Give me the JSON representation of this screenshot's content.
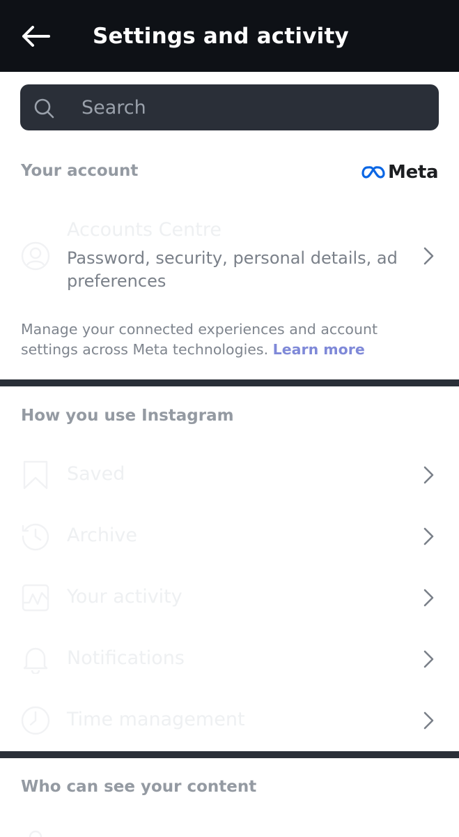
{
  "header": {
    "title": "Settings and activity",
    "back_icon": "arrow-left-icon"
  },
  "search": {
    "placeholder": "Search"
  },
  "your_account": {
    "heading": "Your account",
    "brand": "Meta",
    "accounts_centre": {
      "title": "Accounts Centre",
      "subtitle": "Password, security, personal details, ad preferences"
    },
    "help_text": "Manage your connected experiences and account settings across Meta technologies.",
    "learn_more": "Learn more"
  },
  "how_you_use": {
    "heading": "How you use Instagram",
    "items": [
      {
        "label": "Saved",
        "icon": "bookmark-icon"
      },
      {
        "label": "Archive",
        "icon": "archive-icon"
      },
      {
        "label": "Your activity",
        "icon": "activity-icon"
      },
      {
        "label": "Notifications",
        "icon": "bell-icon"
      },
      {
        "label": "Time management",
        "icon": "clock-icon"
      }
    ]
  },
  "who_can_see": {
    "heading": "Who can see your content"
  },
  "colors": {
    "topbar": "#0e1116",
    "divider": "#2a2f38",
    "link": "#7f89d8"
  }
}
